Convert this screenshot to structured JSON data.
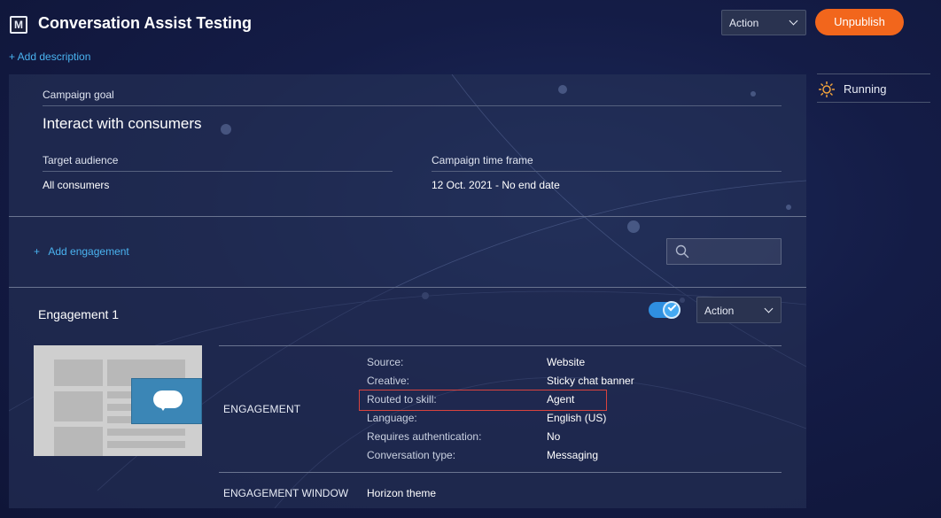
{
  "header": {
    "app_icon_letter": "M",
    "title": "Conversation Assist Testing",
    "add_description": "+ Add description",
    "action_label": "Action",
    "unpublish_label": "Unpublish"
  },
  "status": {
    "icon": "sun-icon",
    "label": "Running",
    "color": "#f2a33c"
  },
  "campaign": {
    "goal_label": "Campaign goal",
    "goal_value": "Interact with consumers",
    "audience_label": "Target audience",
    "audience_value": "All consumers",
    "timeframe_label": "Campaign time frame",
    "timeframe_value": "12 Oct. 2021 - No end date"
  },
  "engagements_toolbar": {
    "add_engagement": "+   Add engagement",
    "search_placeholder": ""
  },
  "engagement": {
    "title": "Engagement 1",
    "enabled": true,
    "action_label": "Action",
    "section_heading": "ENGAGEMENT",
    "rows": [
      {
        "label": "Source:",
        "value": "Website"
      },
      {
        "label": "Creative:",
        "value": "Sticky chat banner"
      },
      {
        "label": "Routed to skill:",
        "value": "Agent"
      },
      {
        "label": "Language:",
        "value": "English (US)"
      },
      {
        "label": "Requires authentication:",
        "value": "No"
      },
      {
        "label": "Conversation type:",
        "value": "Messaging"
      }
    ],
    "window_heading": "ENGAGEMENT WINDOW",
    "window_value": "Horizon theme"
  },
  "colors": {
    "accent": "#4ab3f0",
    "unpublish": "#f2661c",
    "highlight": "#d9433e",
    "toggle": "#2f8fe0"
  }
}
